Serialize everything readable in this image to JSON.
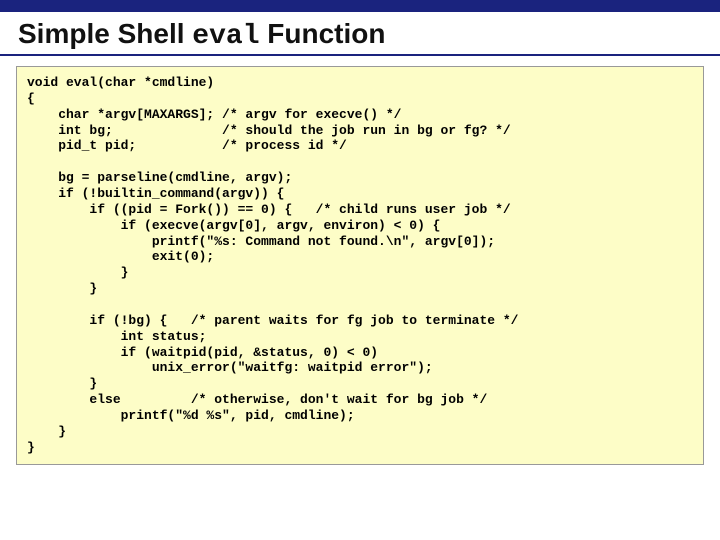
{
  "title": {
    "prefix": "Simple Shell ",
    "code": "eval",
    "suffix": " Function"
  },
  "code": "void eval(char *cmdline)\n{\n    char *argv[MAXARGS]; /* argv for execve() */\n    int bg;              /* should the job run in bg or fg? */\n    pid_t pid;           /* process id */\n\n    bg = parseline(cmdline, argv);\n    if (!builtin_command(argv)) {\n        if ((pid = Fork()) == 0) {   /* child runs user job */\n            if (execve(argv[0], argv, environ) < 0) {\n                printf(\"%s: Command not found.\\n\", argv[0]);\n                exit(0);\n            }\n        }\n\n        if (!bg) {   /* parent waits for fg job to terminate */\n            int status;\n            if (waitpid(pid, &status, 0) < 0)\n                unix_error(\"waitfg: waitpid error\");\n        }\n        else         /* otherwise, don't wait for bg job */\n            printf(\"%d %s\", pid, cmdline);\n    }\n}"
}
